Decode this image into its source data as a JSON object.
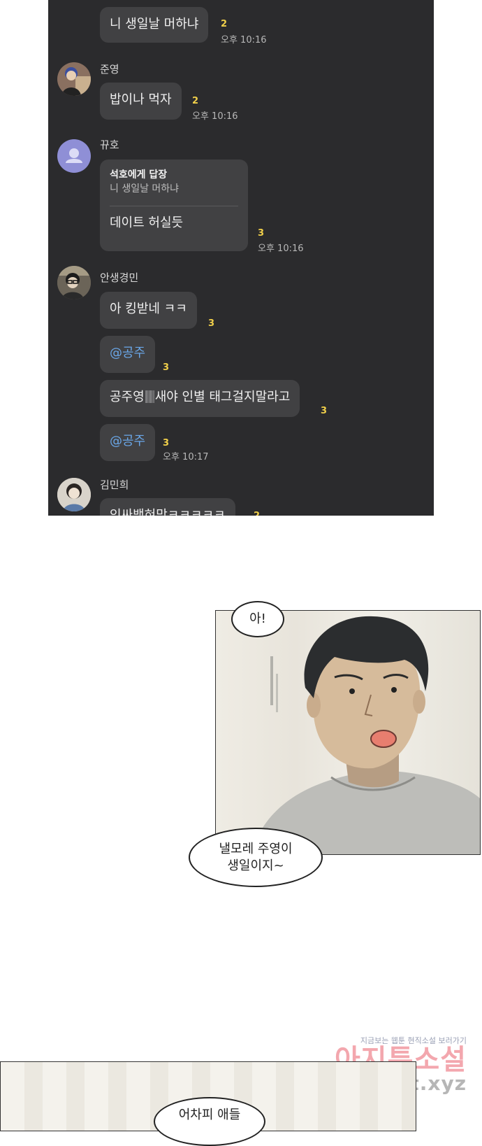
{
  "chat": {
    "messages": [
      {
        "text": "니 생일날 머하냐",
        "unread": "2",
        "time": "오후 10:16"
      },
      {
        "sender": "준영",
        "text": "밥이나 먹자",
        "unread": "2",
        "time": "오후 10:16"
      },
      {
        "sender": "뀨호",
        "reply_title": "석호에게 답장",
        "reply_quote": "니 생일날 머하냐",
        "text": "데이트 허실듯",
        "unread": "3",
        "time": "오후 10:16"
      },
      {
        "sender": "안생경민",
        "text": "아 킹받네 ㅋㅋ",
        "unread": "3"
      },
      {
        "text": "@공주",
        "unread": "3"
      },
      {
        "text_before": "공주영",
        "text_after": "새야 인별 태그걸지말라고",
        "unread": "3"
      },
      {
        "text": "@공주",
        "unread": "3",
        "time": "오후 10:17"
      },
      {
        "sender": "김민희",
        "text": "인싸백혀망ㅋㅋㅋㅋㅋ",
        "unread": "2"
      }
    ]
  },
  "comic": {
    "speech1": "아!",
    "speech2_line1": "낼모레 주영이",
    "speech2_line2": "생일이지~",
    "speech3": "어차피 애들"
  },
  "watermark": {
    "small": "지금보는 웹툰 현직소설 보러가기",
    "big": "아지툰소설",
    "url": "novelagit.xyz"
  },
  "colors": {
    "chat_bg": "#2b2b2d",
    "bubble": "#414143",
    "unread": "#f1d04a",
    "mention": "#6aa7e8"
  }
}
